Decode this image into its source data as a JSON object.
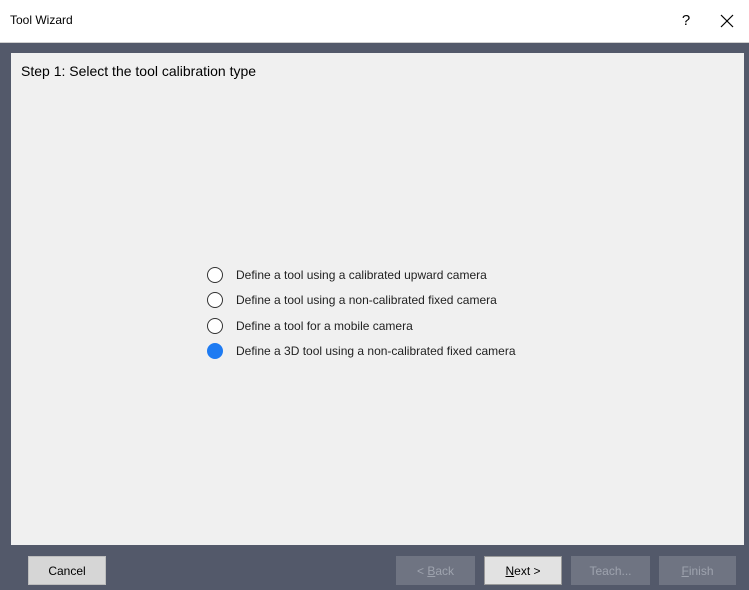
{
  "window": {
    "title": "Tool Wizard",
    "help_label": "?",
    "close_icon": "close-icon"
  },
  "step": {
    "title": "Step 1: Select the tool calibration type"
  },
  "options": [
    {
      "label": "Define a tool using a calibrated upward camera",
      "checked": false
    },
    {
      "label": "Define a tool using a non-calibrated fixed camera",
      "checked": false
    },
    {
      "label": "Define a tool for a mobile camera",
      "checked": false
    },
    {
      "label": "Define a 3D tool using a non-calibrated fixed camera",
      "checked": true
    }
  ],
  "buttons": {
    "cancel": {
      "label": "Cancel",
      "enabled": true
    },
    "back": {
      "prefix": "< ",
      "mnemonic": "B",
      "rest": "ack",
      "enabled": false
    },
    "next": {
      "mnemonic": "N",
      "rest": "ext >",
      "enabled": true
    },
    "teach": {
      "label": "Teach...",
      "enabled": false
    },
    "finish": {
      "mnemonic": "F",
      "rest": "inish",
      "enabled": false
    }
  },
  "colors": {
    "frame": "#53596a",
    "panel": "#f0f0f0",
    "accent": "#1e7bf2"
  }
}
